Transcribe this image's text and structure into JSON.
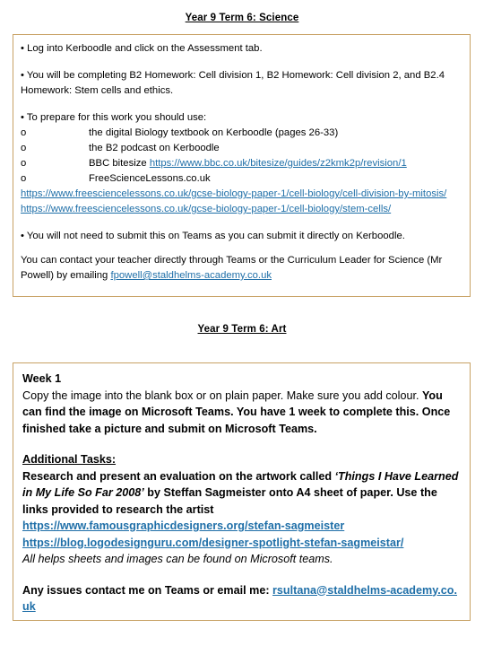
{
  "science": {
    "heading": "Year 9 Term 6: Science",
    "bullet_1": "• Log into Kerboodle and click on the Assessment tab.",
    "bullet_2": "• You will be completing B2 Homework: Cell division 1, B2 Homework: Cell division 2, and B2.4 Homework: Stem cells and ethics.",
    "bullet_3": "• To prepare for this work you should use:",
    "sub_marker": "o",
    "sub_items": [
      "the digital Biology textbook on Kerboodle (pages 26-33)",
      "the B2 podcast on Kerboodle",
      "BBC bitesize ",
      "FreeScienceLessons.co.uk"
    ],
    "bbc_link": "https://www.bbc.co.uk/bitesize/guides/z2kmk2p/revision/1",
    "link_mitosis": "https://www.freesciencelessons.co.uk/gcse-biology-paper-1/cell-biology/cell-division-by-mitosis/",
    "link_stem_cells": "https://www.freesciencelessons.co.uk/gcse-biology-paper-1/cell-biology/stem-cells/",
    "bullet_4": "• You will not need to submit this on Teams as you can submit it directly on Kerboodle.",
    "contact_text": "You can contact your teacher directly through Teams or the Curriculum Leader for Science (Mr Powell)  by emailing ",
    "contact_email": "fpowell@staldhelms-academy.co.uk"
  },
  "art": {
    "heading": "Year 9 Term 6: Art",
    "week_label": "Week 1",
    "week_text_regular": "Copy the image into the blank box or on plain paper. Make sure you add colour. ",
    "week_text_bold": "You can find the image on Microsoft Teams. You have 1 week to complete this. Once finished take a picture and submit on Microsoft Teams.",
    "additional_label": "Additional Tasks:",
    "research_text_1": "Research and present an evaluation on the artwork called ",
    "artwork_title": "‘Things I Have Learned in My Life So Far 2008’",
    "research_text_2": " by Steffan Sagmeister onto A4 sheet of paper. Use the links provided to research the artist",
    "link_famous": "https://www.famousgraphicdesigners.org/stefan-sagmeister",
    "link_blog": "https://blog.logodesignguru.com/designer-spotlight-stefan-sagmeistar/",
    "helps_text": "All helps sheets and images can be found on Microsoft teams.",
    "issues_text": "Any issues contact me on Teams or email me: ",
    "issues_email": "rsultana@staldhelms-academy.co.uk"
  },
  "colors": {
    "border": "#c8a265",
    "link": "#1f6fa8",
    "text": "#000000",
    "background": "#ffffff"
  }
}
